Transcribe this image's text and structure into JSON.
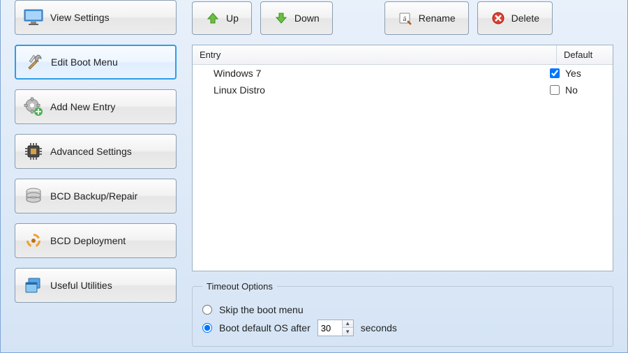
{
  "sidebar": {
    "items": [
      {
        "label": "View Settings",
        "icon": "monitor"
      },
      {
        "label": "Edit Boot Menu",
        "icon": "tools",
        "active": true
      },
      {
        "label": "Add New Entry",
        "icon": "gear-plus"
      },
      {
        "label": "Advanced Settings",
        "icon": "chip"
      },
      {
        "label": "BCD Backup/Repair",
        "icon": "database"
      },
      {
        "label": "BCD Deployment",
        "icon": "recycle"
      },
      {
        "label": "Useful Utilities",
        "icon": "windows-stack"
      }
    ]
  },
  "toolbar": {
    "up_label": "Up",
    "down_label": "Down",
    "rename_label": "Rename",
    "delete_label": "Delete"
  },
  "list": {
    "columns": {
      "entry": "Entry",
      "default": "Default"
    },
    "rows": [
      {
        "entry": "Windows 7",
        "default_checked": true,
        "default_label": "Yes"
      },
      {
        "entry": "Linux Distro",
        "default_checked": false,
        "default_label": "No"
      }
    ]
  },
  "timeout": {
    "legend": "Timeout Options",
    "skip_label": "Skip the boot menu",
    "boot_label_pre": "Boot default OS after",
    "boot_value": "30",
    "boot_label_post": "seconds",
    "selected": "boot"
  }
}
